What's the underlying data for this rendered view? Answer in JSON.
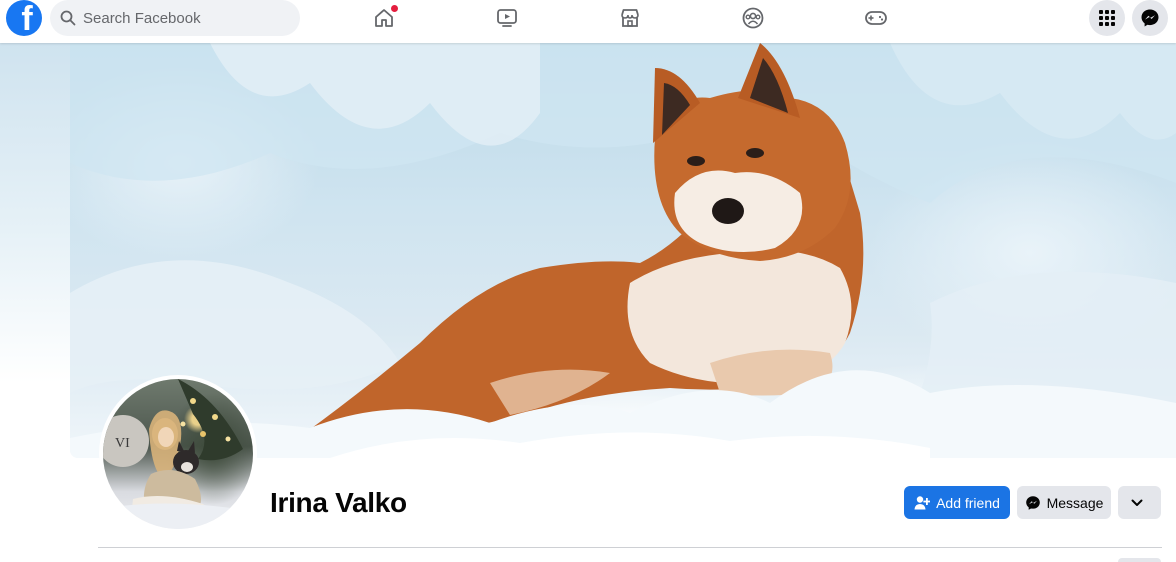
{
  "header": {
    "logo_letter": "f",
    "search": {
      "placeholder": "Search Facebook",
      "value": ""
    },
    "nav": [
      {
        "icon": "home-icon",
        "notification_dot": true
      },
      {
        "icon": "watch-icon",
        "notification_dot": false
      },
      {
        "icon": "marketplace-icon",
        "notification_dot": false
      },
      {
        "icon": "groups-icon",
        "notification_dot": false
      },
      {
        "icon": "gaming-icon",
        "notification_dot": false
      }
    ],
    "right": [
      "menu-grid-icon",
      "messenger-icon"
    ]
  },
  "profile": {
    "name": "Irina Valko",
    "actions": {
      "add_friend": "Add friend",
      "message": "Message",
      "more": "chevron-down-icon"
    }
  },
  "colors": {
    "brand": "#1877f2",
    "primary_button": "#1b74e4",
    "secondary_button": "#e4e6eb",
    "notification": "#e41e3f"
  }
}
